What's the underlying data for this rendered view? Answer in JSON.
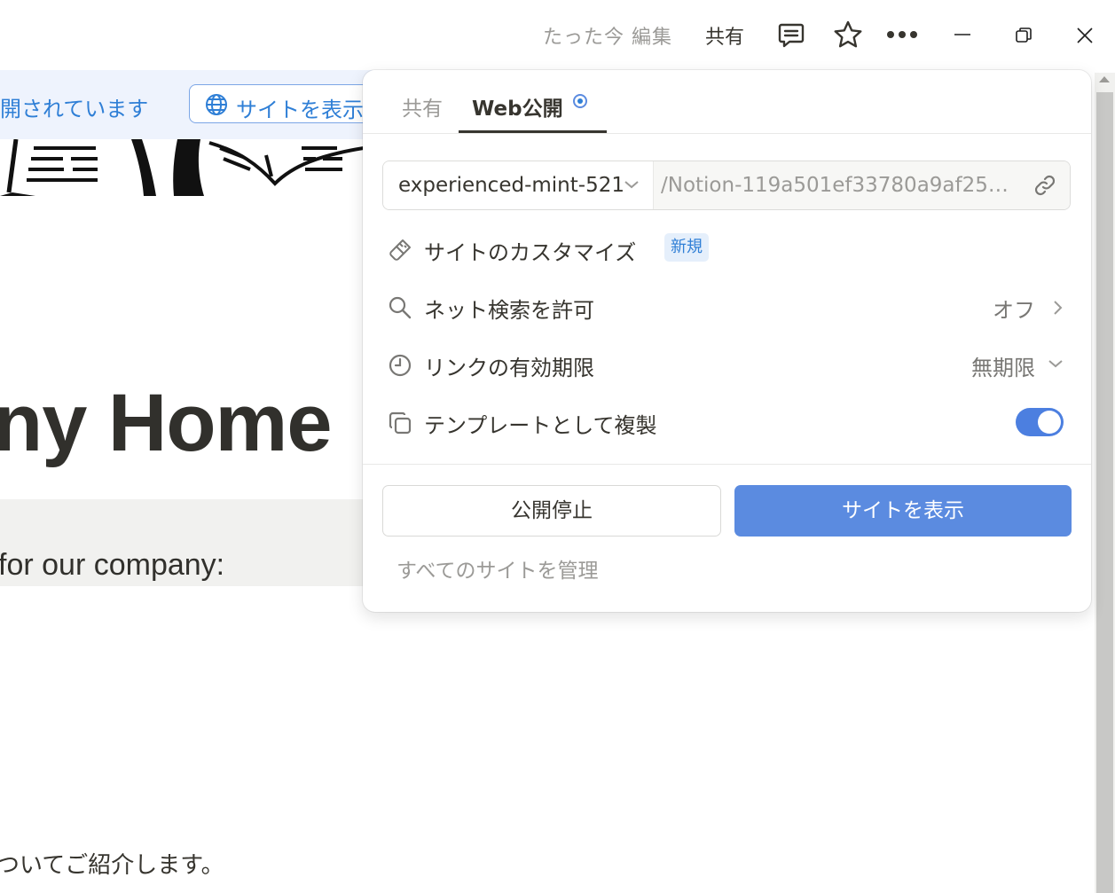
{
  "topbar": {
    "edited_label": "たった今 編集",
    "share_label": "共有"
  },
  "page": {
    "published_text": "開されています",
    "view_site_button": "サイトを表示",
    "title": "ny Home",
    "callout_text": "for our company:",
    "body_text": "ついてご紹介します。"
  },
  "popover": {
    "tabs": [
      {
        "label": "共有"
      },
      {
        "label": "Web公開"
      }
    ],
    "url": {
      "domain": "experienced-mint-521",
      "path": "/Notion-119a501ef33780a9af25c8a..."
    },
    "rows": {
      "customize": {
        "label": "サイトのカスタマイズ",
        "badge": "新規"
      },
      "search": {
        "label": "ネット検索を許可",
        "value": "オフ"
      },
      "expiry": {
        "label": "リンクの有効期限",
        "value": "無期限"
      },
      "template": {
        "label": "テンプレートとして複製",
        "enabled": true
      }
    },
    "unpublish_button": "公開停止",
    "view_site_button": "サイトを表示",
    "manage_link": "すべてのサイトを管理"
  },
  "colors": {
    "accent": "#5b8be0",
    "link_blue": "#2f7fd6"
  }
}
